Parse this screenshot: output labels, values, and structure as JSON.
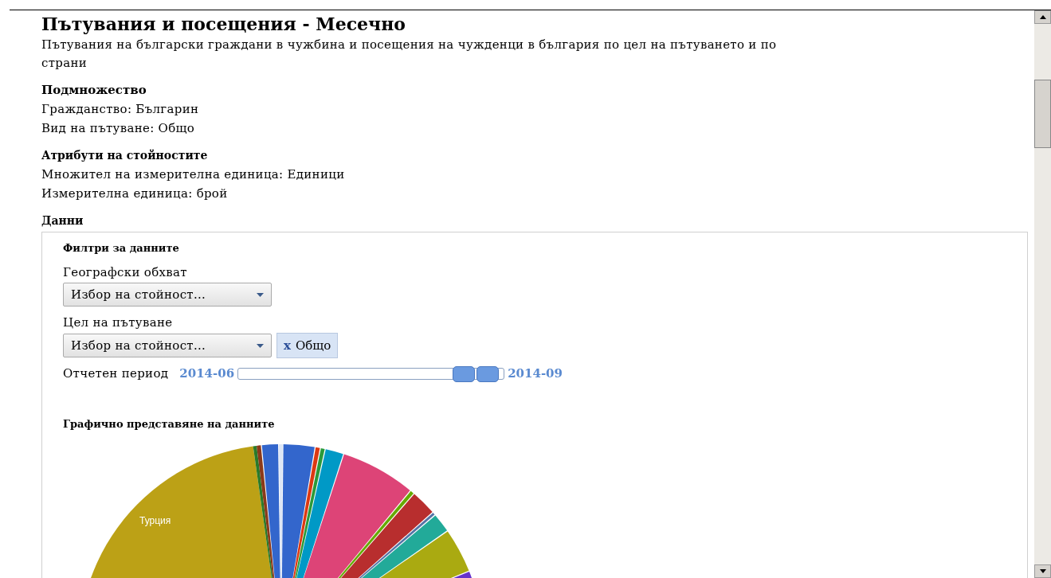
{
  "title": "Пътувания и посещения - Месечно",
  "description": "Пътувания на български граждани в чужбина и посещения на чужденци в българия по цел на пътуването и по страни",
  "sections": [
    {
      "heading": "Подмножество",
      "lines": [
        "Гражданство: Българин",
        "Вид на пътуване: Общо"
      ]
    },
    {
      "heading": "Атрибути на стойностите",
      "lines": [
        "Множител на измерителна единица: Единици",
        "Измерителна единица: брой"
      ]
    }
  ],
  "data_heading": "Данни",
  "filters": {
    "heading": "Филтри за данните",
    "fields": [
      {
        "label": "Географски обхват",
        "placeholder": "Избор на стойност..."
      },
      {
        "label": "Цел на пътуване",
        "placeholder": "Избор на стойност...",
        "tags": [
          {
            "remove": "x",
            "label": "Общо"
          }
        ]
      }
    ],
    "period": {
      "label": "Отчетен период",
      "from": "2014-06",
      "to": "2014-09",
      "handles": [
        {
          "level": 0.85
        },
        {
          "level": 0.94
        }
      ]
    }
  },
  "chart": {
    "heading": "Графично представяне на данните",
    "slice_label": "Турция"
  }
}
